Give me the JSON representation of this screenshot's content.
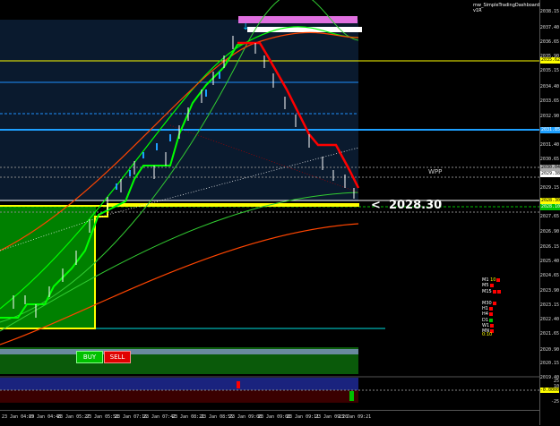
{
  "window": {
    "title": "mw_SimpleTradingDashboard v1R"
  },
  "price_display": {
    "value": "2028.30",
    "prefix": "<"
  },
  "labels": {
    "wpp": "WPP"
  },
  "buttons": {
    "buy": "BUY",
    "sell": "SELL"
  },
  "price_axis": [
    "2038.15",
    "2037.40",
    "2036.65",
    "2035.90",
    "2035.15",
    "2034.40",
    "2033.65",
    "2032.90",
    "2032.15",
    "2031.40",
    "2030.65",
    "2029.90",
    "2029.15",
    "2028.40",
    "2027.65",
    "2026.90",
    "2026.15",
    "2025.40",
    "2024.65",
    "2023.90",
    "2023.15",
    "2022.40",
    "2021.65",
    "2020.90",
    "2020.15",
    "2019.40",
    "2018.65"
  ],
  "price_tags": [
    {
      "text": "2035.62",
      "color": "#ffff00"
    },
    {
      "text": "2031.85",
      "color": "#1ea0ff"
    },
    {
      "text": "2030.04",
      "color": "#aaaaaa"
    },
    {
      "text": "2029.38",
      "color": "#ffffff"
    },
    {
      "text": "2028.30",
      "color": "#ffff00"
    },
    {
      "text": "2028.10",
      "color": "#00c000"
    }
  ],
  "indicator_axis": {
    "top": [
      "25",
      "10"
    ],
    "zero": "-0.0000",
    "bottom": "-25"
  },
  "time_axis": [
    "23 Jan 04:09",
    "23 Jan 04:40",
    "23 Jan 05:27",
    "23 Jan 05:58",
    "23 Jan 07:16",
    "23 Jan 07:42",
    "23 Jan 08:21",
    "23 Jan 08:55",
    "23 Jan 09:00",
    "23 Jan 09:08",
    "23 Jan 09:11",
    "23 Jan 09:20",
    "23 Jan 09:21"
  ],
  "timeframes": [
    {
      "label": "M1",
      "value": "10",
      "colors": [
        "#ff0000"
      ]
    },
    {
      "label": "M5",
      "value": "",
      "colors": [
        "#ff0000"
      ]
    },
    {
      "label": "M15",
      "value": "",
      "colors": [
        "#ff0000",
        "#ff0000"
      ]
    },
    {
      "label": "M30",
      "value": "",
      "colors": [
        "#ff0000"
      ]
    },
    {
      "label": "H1",
      "value": "",
      "colors": [
        "#ff0000"
      ]
    },
    {
      "label": "H4",
      "value": "",
      "colors": [
        "#ff0000"
      ]
    },
    {
      "label": "D1",
      "value": "",
      "colors": [
        "#00c000"
      ]
    },
    {
      "label": "W1",
      "value": "",
      "colors": [
        "#ff0000"
      ]
    },
    {
      "label": "MN",
      "value": "",
      "colors": [
        "#ff0000"
      ]
    },
    {
      "label": "",
      "value": "0:10",
      "colors": []
    }
  ],
  "colors": {
    "up": "#00c000",
    "down": "#ff0000",
    "accent": "#ffff00",
    "sky": "#1ea0ff"
  }
}
